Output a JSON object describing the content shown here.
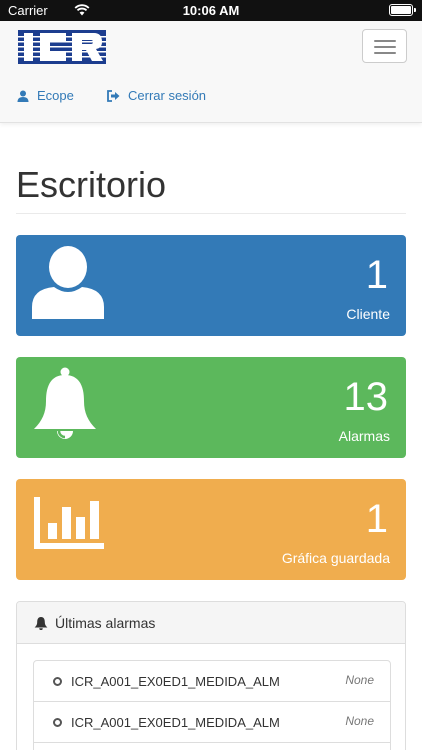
{
  "status_bar": {
    "carrier": "Carrier",
    "time": "10:06 AM"
  },
  "navbar": {
    "logo_text": "ICR",
    "links": [
      {
        "label": "Ecope",
        "icon": "user-icon"
      },
      {
        "label": "Cerrar sesión",
        "icon": "sign-out-icon"
      }
    ]
  },
  "page": {
    "title": "Escritorio"
  },
  "panels": [
    {
      "value": "1",
      "label": "Cliente",
      "icon": "user-icon",
      "color": "#337ab7"
    },
    {
      "value": "13",
      "label": "Alarmas",
      "icon": "bell-icon",
      "color": "#5cb85c"
    },
    {
      "value": "1",
      "label": "Gráfica guardada",
      "icon": "bar-chart-icon",
      "color": "#f0ad4e"
    }
  ],
  "alarms": {
    "heading": "Últimas alarmas",
    "items": [
      {
        "name": "ICR_A001_EX0ED1_MEDIDA_ALM",
        "value": "None"
      },
      {
        "name": "ICR_A001_EX0ED1_MEDIDA_ALM",
        "value": "None"
      },
      {
        "name": "",
        "value": ""
      }
    ]
  }
}
